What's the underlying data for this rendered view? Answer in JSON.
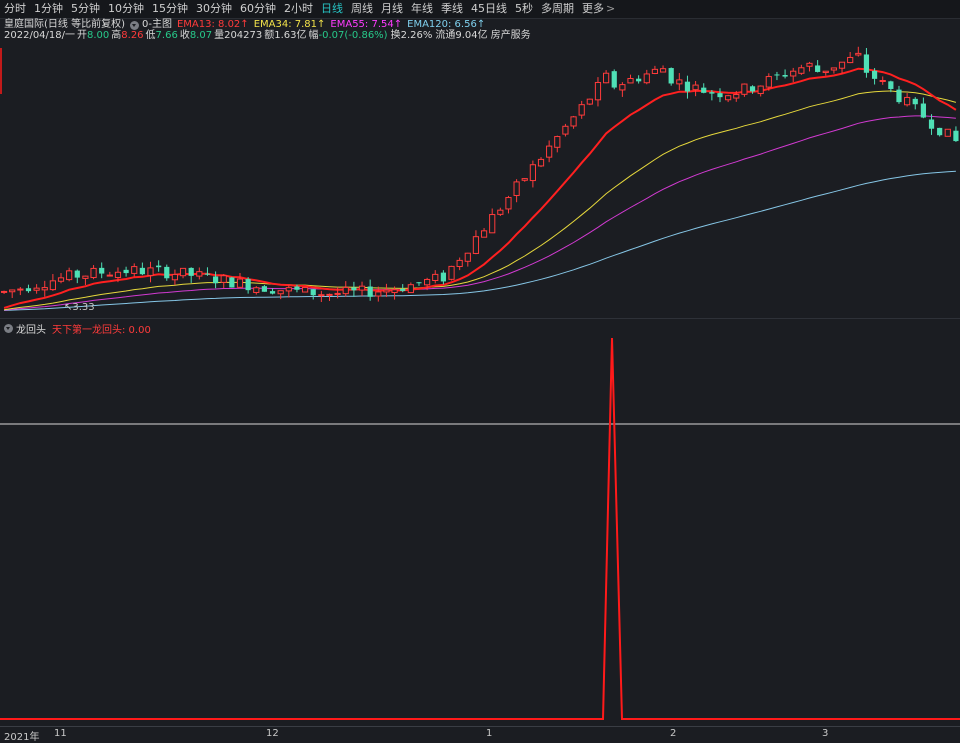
{
  "toolbar": {
    "periods": [
      "分时",
      "1分钟",
      "5分钟",
      "10分钟",
      "15分钟",
      "30分钟",
      "60分钟",
      "2小时",
      "日线",
      "周线",
      "月线",
      "年线",
      "季线",
      "45日线",
      "5秒",
      "多周期",
      "更多"
    ],
    "active": "日线",
    "more_chevron": ">"
  },
  "header": {
    "stock": "皇庭国际(日线 等比前复权)",
    "main_label": "0-主图",
    "ema13": "EMA13: 8.02↑",
    "ema34": "EMA34: 7.81↑",
    "ema55": "EMA55: 7.54↑",
    "ema120": "EMA120: 6.56↑",
    "date": "2022/04/18/一",
    "open_label": "开",
    "open": "8.00",
    "high_label": "高",
    "high": "8.26",
    "low_label": "低",
    "low": "7.66",
    "close_label": "收",
    "close": "8.07",
    "vol_label": "量",
    "vol": "204273",
    "amt_label": "额",
    "amt": "1.63亿",
    "chg_label": "幅",
    "chg": "-0.07(-0.86%)",
    "turnover": "换2.26%",
    "float": "流通9.04亿",
    "industry": "房产服务"
  },
  "main": {
    "low_marker": "3.33"
  },
  "colors": {
    "up": "#ff3b3b",
    "down": "#4fe0b6",
    "ema13": "#ff2020",
    "ema34": "#e6d83c",
    "ema55": "#d23ad2",
    "ema120": "#86c6e6",
    "indicator": "#ff1a1a"
  },
  "sub": {
    "title": "龙回头",
    "series_label": "天下第一龙回头: 0.00"
  },
  "xaxis": {
    "labels": [
      "2021年",
      "11",
      "12",
      "1",
      "2",
      "3"
    ]
  }
}
